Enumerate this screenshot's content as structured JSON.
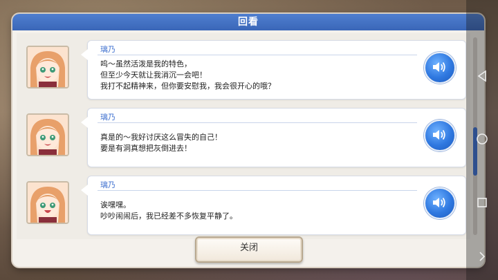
{
  "dialog": {
    "title": "回看",
    "close_label": "关闭",
    "accent": "#3d6fcf"
  },
  "entries": [
    {
      "speaker": "璃乃",
      "lines": [
        "呜～虽然活泼是我的特色，",
        "但至少今天就让我消沉一会吧！",
        "我打不起精神来，但你要安慰我，我会很开心的哦？"
      ]
    },
    {
      "speaker": "璃乃",
      "lines": [
        "真是的～我好讨厌这么冒失的自己！",
        "要是有洞真想把灰倒进去！"
      ]
    },
    {
      "speaker": "璃乃",
      "lines": [
        "诶嘿嘿。",
        "吵吵闹闹后，我已经差不多恢复平静了。"
      ]
    }
  ],
  "icons": {
    "voice": "speaker-icon",
    "nav_back": "back-triangle-icon",
    "nav_home": "home-circle-icon",
    "nav_recent": "recent-square-icon",
    "nav_more": "chevron-right-icon"
  },
  "scroll_progress": 0.6
}
